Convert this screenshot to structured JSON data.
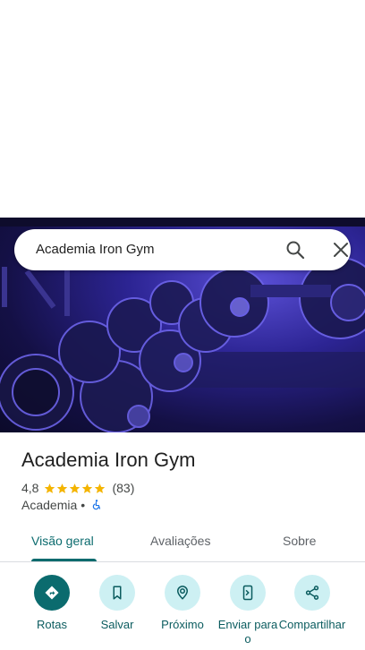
{
  "search": {
    "query": "Academia Iron Gym",
    "search_icon": "search-icon",
    "close_icon": "close-icon"
  },
  "place": {
    "name": "Academia Iron Gym",
    "rating": "4,8",
    "stars": 5,
    "review_count": "(83)",
    "category": "Academia",
    "separator": "•",
    "accessibility_icon": "wheelchair-icon"
  },
  "tabs": [
    {
      "label": "Visão geral",
      "active": true
    },
    {
      "label": "Avaliações",
      "active": false
    },
    {
      "label": "Sobre",
      "active": false
    }
  ],
  "actions": [
    {
      "label": "Rotas",
      "icon": "directions-icon"
    },
    {
      "label": "Salvar",
      "icon": "bookmark-icon"
    },
    {
      "label": "Próximo",
      "icon": "nearby-icon"
    },
    {
      "label": "Enviar para o",
      "icon": "send-to-phone-icon"
    },
    {
      "label": "Compartilhar",
      "icon": "share-icon"
    }
  ],
  "colors": {
    "accent": "#0b6b6e",
    "action_bg": "#cdf0f3",
    "star": "#f4b400"
  }
}
